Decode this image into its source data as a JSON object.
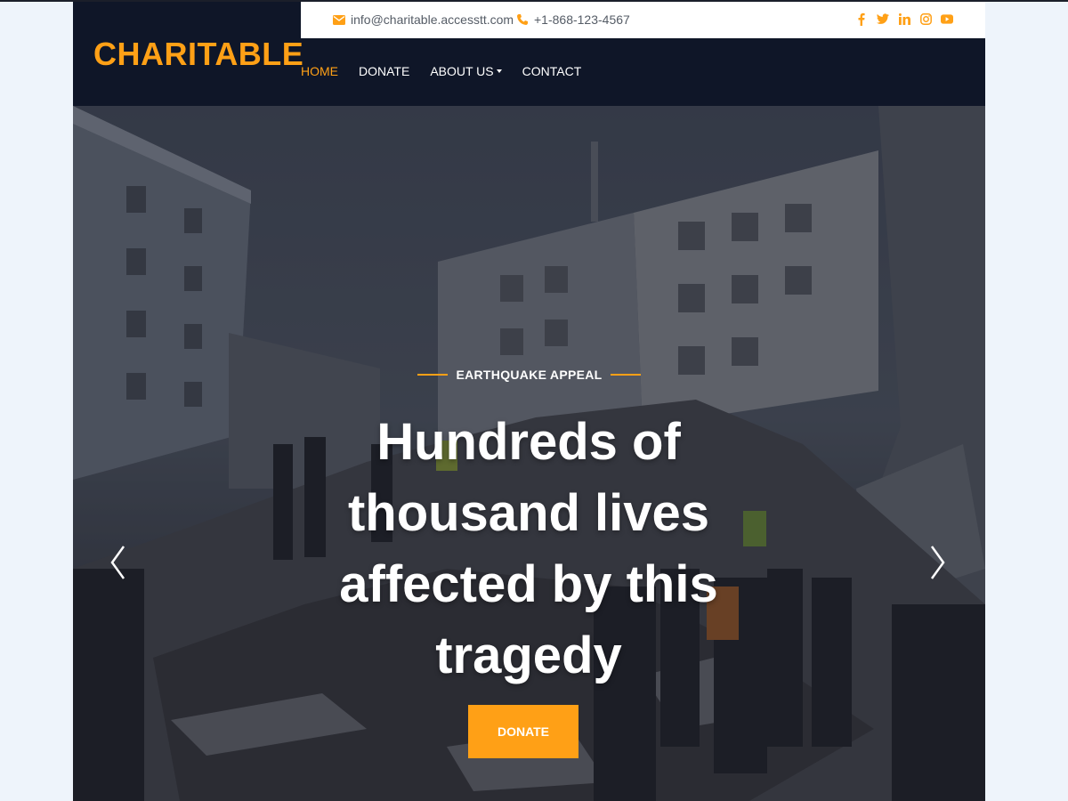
{
  "brand": {
    "logo_text": "CHARITABLE",
    "accent_color": "#ffa016",
    "header_bg": "#0f1628"
  },
  "topbar": {
    "email": "info@charitable.accesstt.com",
    "phone": "+1-868-123-4567",
    "email_icon": "envelope-icon",
    "phone_icon": "phone-icon",
    "socials": [
      {
        "name": "facebook-icon",
        "glyph": "f"
      },
      {
        "name": "twitter-icon",
        "glyph": "t"
      },
      {
        "name": "linkedin-icon",
        "glyph": "in"
      },
      {
        "name": "instagram-icon",
        "glyph": "ig"
      },
      {
        "name": "youtube-icon",
        "glyph": "yt"
      }
    ]
  },
  "nav": {
    "items": [
      {
        "label": "HOME",
        "active": true
      },
      {
        "label": "DONATE",
        "active": false
      },
      {
        "label": "ABOUT US",
        "active": false,
        "dropdown": true
      },
      {
        "label": "CONTACT",
        "active": false
      }
    ]
  },
  "hero": {
    "eyebrow": "EARTHQUAKE APPEAL",
    "headline": "Hundreds of thousand lives affected by this tragedy",
    "cta_label": "DONATE",
    "prev_icon": "chevron-left-icon",
    "next_icon": "chevron-right-icon",
    "background_description_icon": "hero-image"
  }
}
